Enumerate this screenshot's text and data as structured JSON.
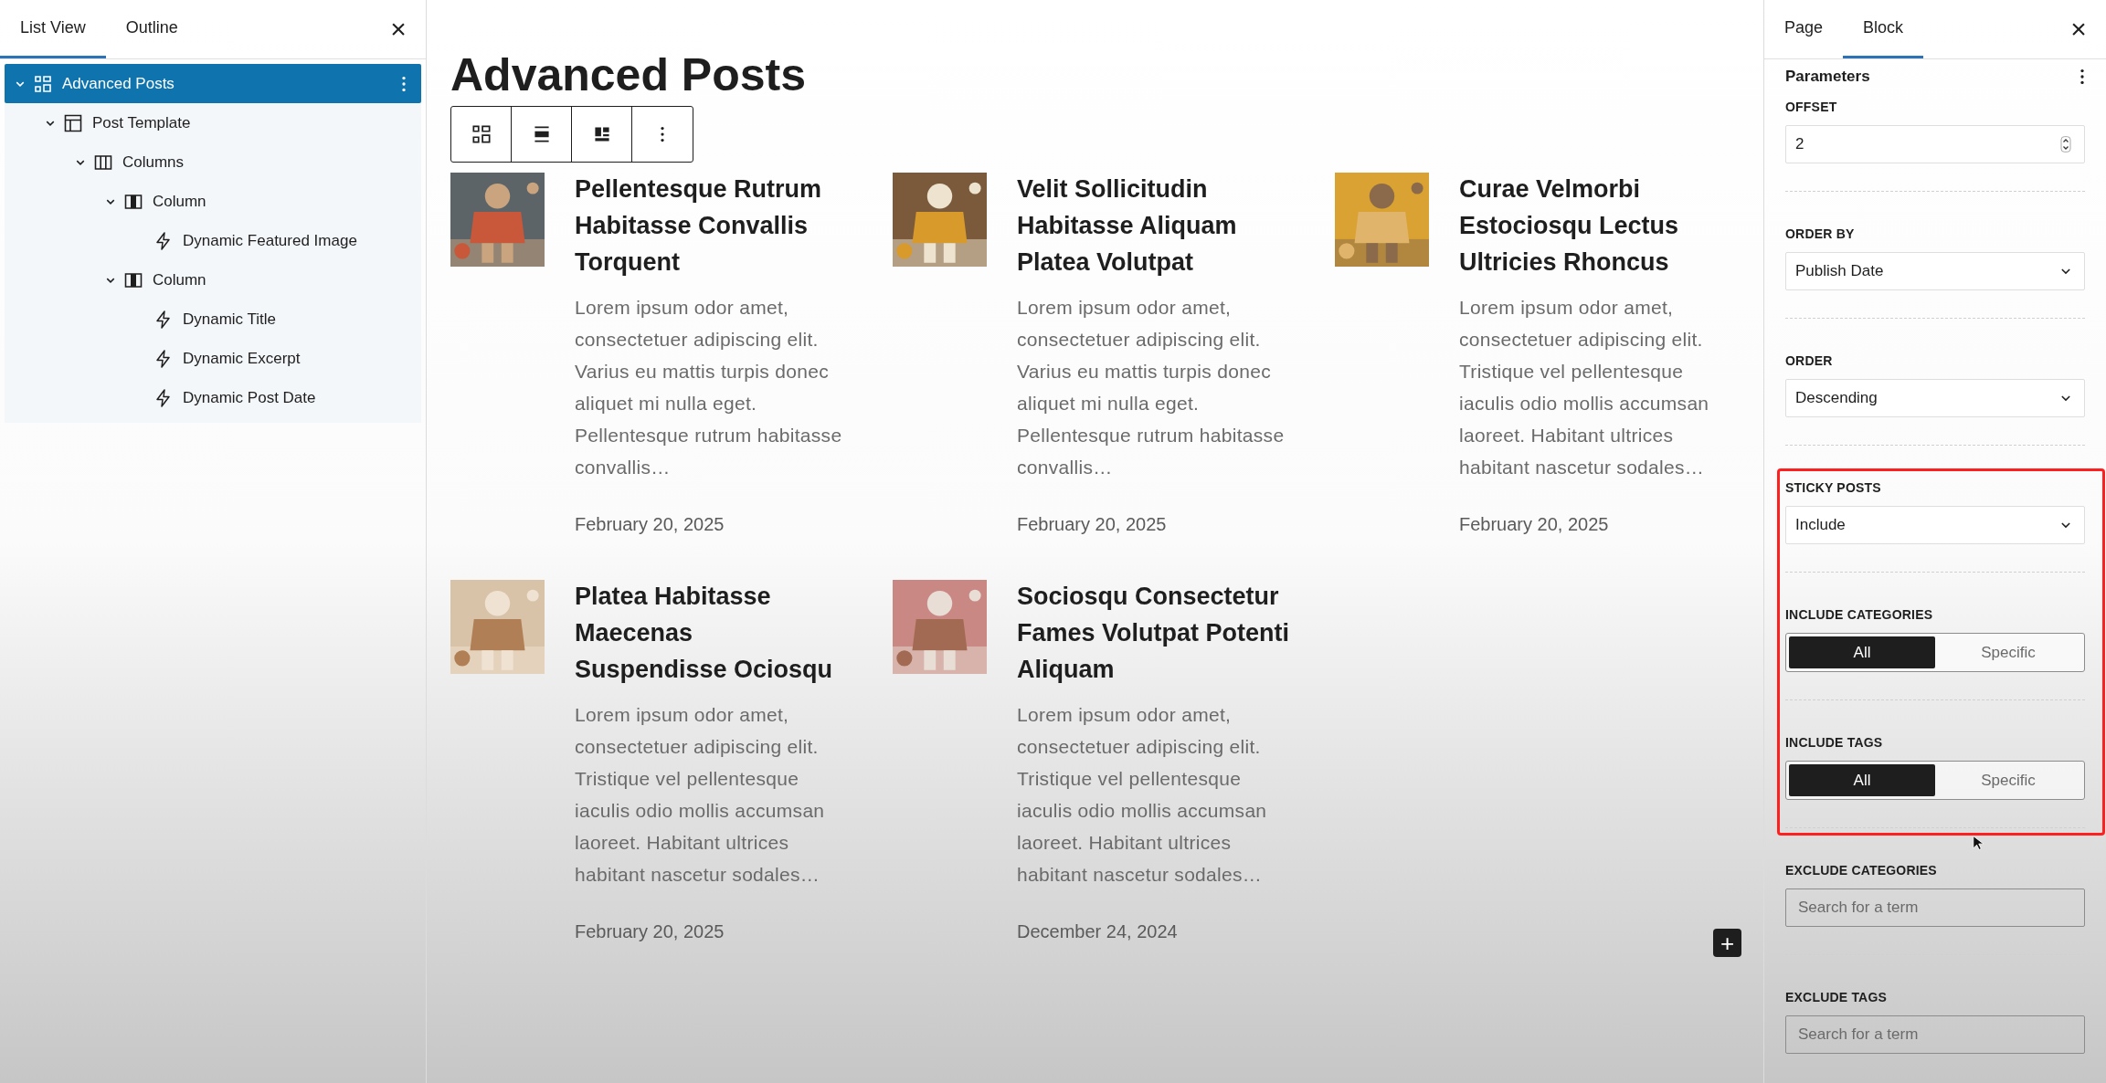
{
  "list_panel": {
    "tabs": [
      {
        "label": "List View",
        "selected": true
      },
      {
        "label": "Outline",
        "selected": false
      }
    ],
    "close": "×",
    "tree": [
      {
        "label": "Advanced Posts",
        "kind": "query",
        "selected": true,
        "expanded": true,
        "children": [
          {
            "label": "Post Template",
            "kind": "template",
            "selected": false,
            "expanded": true,
            "children": [
              {
                "label": "Columns",
                "kind": "columns",
                "selected": false,
                "expanded": true,
                "children": [
                  {
                    "label": "Column",
                    "kind": "column",
                    "selected": false,
                    "expanded": true,
                    "children": [
                      {
                        "label": "Dynamic Featured Image",
                        "kind": "dynamic",
                        "selected": false
                      }
                    ]
                  },
                  {
                    "label": "Column",
                    "kind": "column",
                    "selected": false,
                    "expanded": true,
                    "children": [
                      {
                        "label": "Dynamic Title",
                        "kind": "dynamic",
                        "selected": false
                      },
                      {
                        "label": "Dynamic Excerpt",
                        "kind": "dynamic",
                        "selected": false
                      },
                      {
                        "label": "Dynamic Post Date",
                        "kind": "dynamic",
                        "selected": false
                      }
                    ]
                  }
                ]
              }
            ]
          }
        ]
      }
    ]
  },
  "canvas": {
    "title": "Advanced Posts",
    "posts": [
      {
        "title": "Pellentesque Rutrum Habitasse Convallis Torquent",
        "excerpt": "Lorem ipsum odor amet, consectetuer adipiscing elit. Varius eu mattis turpis donec aliquet mi nulla eget. Pellentesque rutrum habitasse convallis…",
        "date": "February 20, 2025"
      },
      {
        "title": "Velit Sollicitudin Habitasse Aliquam Platea Volutpat",
        "excerpt": "Lorem ipsum odor amet, consectetuer adipiscing elit. Varius eu mattis turpis donec aliquet mi nulla eget. Pellentesque rutrum habitasse convallis…",
        "date": "February 20, 2025"
      },
      {
        "title": "Curae Velmorbi Estociosqu Lectus Ultricies Rhoncus",
        "excerpt": "Lorem ipsum odor amet, consectetuer adipiscing elit. Tristique vel pellentesque iaculis odio mollis accumsan laoreet. Habitant ultrices habitant nascetur sodales…",
        "date": "February 20, 2025"
      },
      {
        "title": "Platea Habitasse Maecenas Suspendisse Ociosqu",
        "excerpt": "Lorem ipsum odor amet, consectetuer adipiscing elit. Tristique vel pellentesque iaculis odio mollis accumsan laoreet. Habitant ultrices habitant nascetur sodales…",
        "date": "February 20, 2025"
      },
      {
        "title": "Sociosqu Consectetur Fames Volutpat Potenti Aliquam",
        "excerpt": "Lorem ipsum odor amet, consectetuer adipiscing elit. Tristique vel pellentesque iaculis odio mollis accumsan laoreet. Habitant ultrices habitant nascetur sodales…",
        "date": "December 24, 2024"
      }
    ],
    "add_block": "+"
  },
  "settings_panel": {
    "tabs": [
      {
        "label": "Page",
        "selected": false
      },
      {
        "label": "Block",
        "selected": true
      }
    ],
    "close": "×",
    "section_title": "Parameters",
    "fields": [
      {
        "label": "OFFSET",
        "kind": "number",
        "value": "2"
      },
      {
        "label": "ORDER BY",
        "kind": "select",
        "value": "Publish Date"
      },
      {
        "label": "ORDER",
        "kind": "select",
        "value": "Descending"
      },
      {
        "label": "STICKY POSTS",
        "kind": "select",
        "value": "Include"
      },
      {
        "label": "INCLUDE CATEGORIES",
        "kind": "segmented",
        "options": [
          {
            "label": "All",
            "selected": true
          },
          {
            "label": "Specific",
            "selected": false
          }
        ]
      },
      {
        "label": "INCLUDE TAGS",
        "kind": "segmented",
        "options": [
          {
            "label": "All",
            "selected": true
          },
          {
            "label": "Specific",
            "selected": false
          }
        ]
      },
      {
        "label": "EXCLUDE CATEGORIES",
        "kind": "search",
        "placeholder": "Search for a term"
      },
      {
        "label": "EXCLUDE TAGS",
        "kind": "search",
        "placeholder": "Search for a term"
      }
    ]
  }
}
